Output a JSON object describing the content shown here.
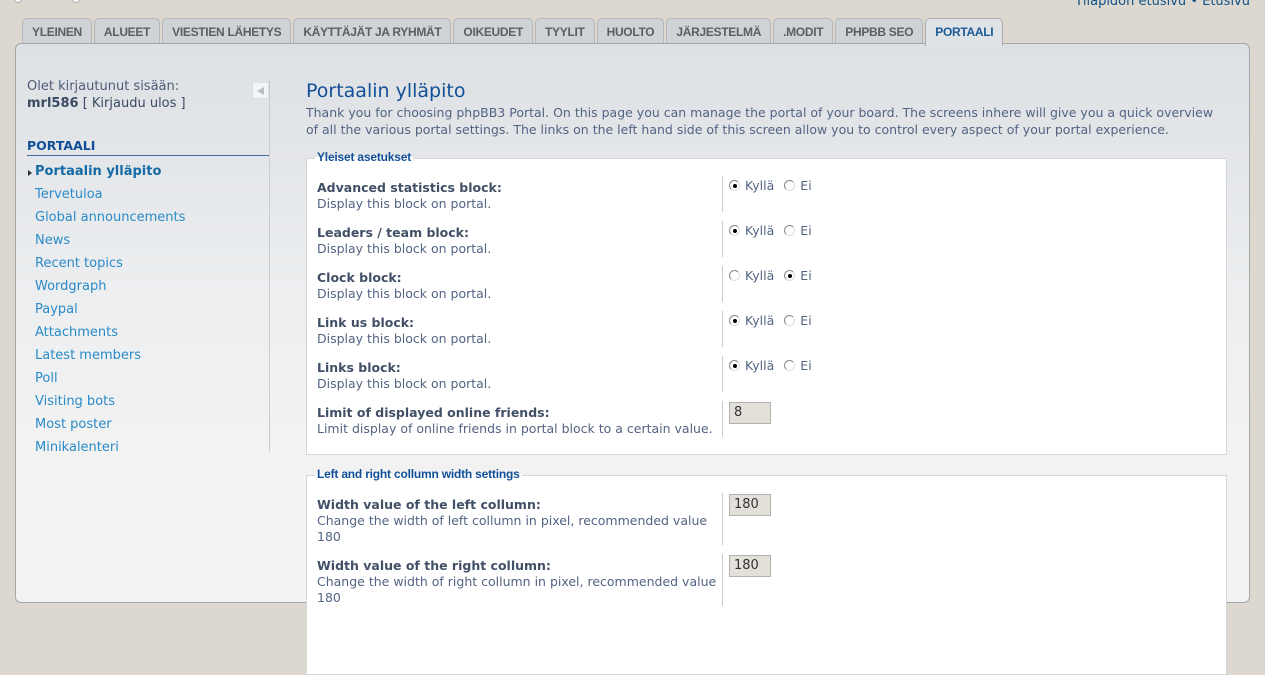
{
  "top_links": {
    "admin_index": "Ylläpidon etusivu",
    "separator": "•",
    "board_index": "Etusivu"
  },
  "tabs": [
    {
      "label": "YLEINEN",
      "active": false
    },
    {
      "label": "ALUEET",
      "active": false
    },
    {
      "label": "VIESTIEN LÄHETYS",
      "active": false
    },
    {
      "label": "KÄYTTÄJÄT JA RYHMÄT",
      "active": false
    },
    {
      "label": "OIKEUDET",
      "active": false
    },
    {
      "label": "TYYLIT",
      "active": false
    },
    {
      "label": "HUOLTO",
      "active": false
    },
    {
      "label": "JÄRJESTELMÄ",
      "active": false
    },
    {
      "label": ".MODIT",
      "active": false
    },
    {
      "label": "PHPBB SEO",
      "active": false
    },
    {
      "label": "PORTAALI",
      "active": true
    }
  ],
  "sidebar": {
    "logged_in_text": "Olet kirjautunut sisään:",
    "username": "mrl586",
    "logout_label": "[ Kirjaudu ulos ]",
    "section_title": "PORTAALI",
    "items": [
      {
        "label": "Portaalin ylläpito",
        "active": true
      },
      {
        "label": "Tervetuloa"
      },
      {
        "label": "Global announcements"
      },
      {
        "label": "News"
      },
      {
        "label": "Recent topics"
      },
      {
        "label": "Wordgraph"
      },
      {
        "label": "Paypal"
      },
      {
        "label": "Attachments"
      },
      {
        "label": "Latest members"
      },
      {
        "label": "Poll"
      },
      {
        "label": "Visiting bots"
      },
      {
        "label": "Most poster"
      },
      {
        "label": "Minikalenteri"
      }
    ]
  },
  "main": {
    "title": "Portaalin ylläpito",
    "intro": "Thank you for choosing phpBB3 Portal. On this page you can manage the portal of your board. The screens inhere will give you a quick overview of all the various portal settings. The links on the left hand side of this screen allow you to control every aspect of your portal experience.",
    "yes_label": "Kyllä",
    "no_label": "Ei",
    "general": {
      "legend": "Yleiset asetukset",
      "rows": [
        {
          "title": "Advanced statistics block:",
          "desc": "Display this block on portal.",
          "value": "yes"
        },
        {
          "title": "Leaders / team block:",
          "desc": "Display this block on portal.",
          "value": "yes"
        },
        {
          "title": "Clock block:",
          "desc": "Display this block on portal.",
          "value": "no"
        },
        {
          "title": "Link us block:",
          "desc": "Display this block on portal.",
          "value": "yes"
        },
        {
          "title": "Links block:",
          "desc": "Display this block on portal.",
          "value": "yes"
        },
        {
          "title": "Limit of displayed online friends:",
          "desc": "Limit display of online friends in portal block to a certain value.",
          "input": "8"
        }
      ]
    },
    "columns": {
      "legend": "Left and right collumn width settings",
      "rows": [
        {
          "title": "Width value of the left collumn:",
          "desc": "Change the width of left collumn in pixel, recommended value 180",
          "input": "180"
        },
        {
          "title": "Width value of the right collumn:",
          "desc": "Change the width of right collumn in pixel, recommended value 180",
          "input": "180"
        }
      ]
    }
  }
}
